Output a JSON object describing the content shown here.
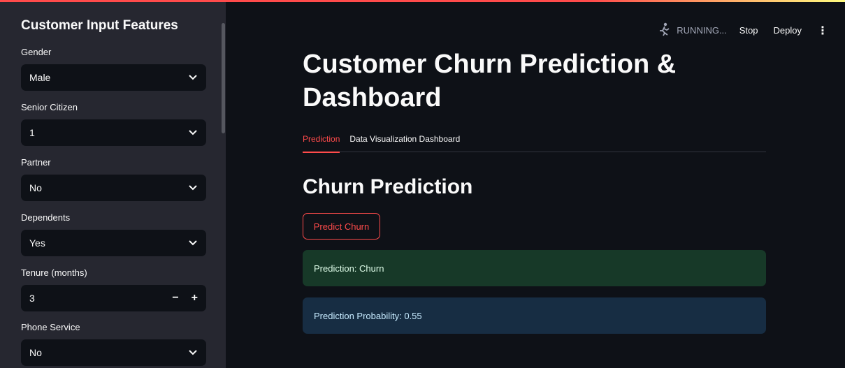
{
  "sidebar": {
    "title": "Customer Input Features",
    "fields": [
      {
        "label": "Gender",
        "value": "Male",
        "type": "select"
      },
      {
        "label": "Senior Citizen",
        "value": "1",
        "type": "select"
      },
      {
        "label": "Partner",
        "value": "No",
        "type": "select"
      },
      {
        "label": "Dependents",
        "value": "Yes",
        "type": "select"
      },
      {
        "label": "Tenure (months)",
        "value": "3",
        "type": "number"
      },
      {
        "label": "Phone Service",
        "value": "No",
        "type": "select"
      }
    ]
  },
  "header": {
    "status": "RUNNING...",
    "stop_label": "Stop",
    "deploy_label": "Deploy",
    "menu_icon": "kebab-icon"
  },
  "main": {
    "title": "Customer Churn Prediction & Dashboard",
    "tabs": [
      {
        "label": "Prediction",
        "active": true
      },
      {
        "label": "Data Visualization Dashboard",
        "active": false
      }
    ],
    "section_title": "Churn Prediction",
    "predict_button": "Predict Churn",
    "prediction_result": "Prediction: Churn",
    "prediction_probability": "Prediction Probability: 0.55"
  },
  "colors": {
    "accent": "#ff4b4b",
    "background": "#0e1117",
    "sidebar": "#262730",
    "success_bg": "#173928",
    "info_bg": "#172d43"
  }
}
